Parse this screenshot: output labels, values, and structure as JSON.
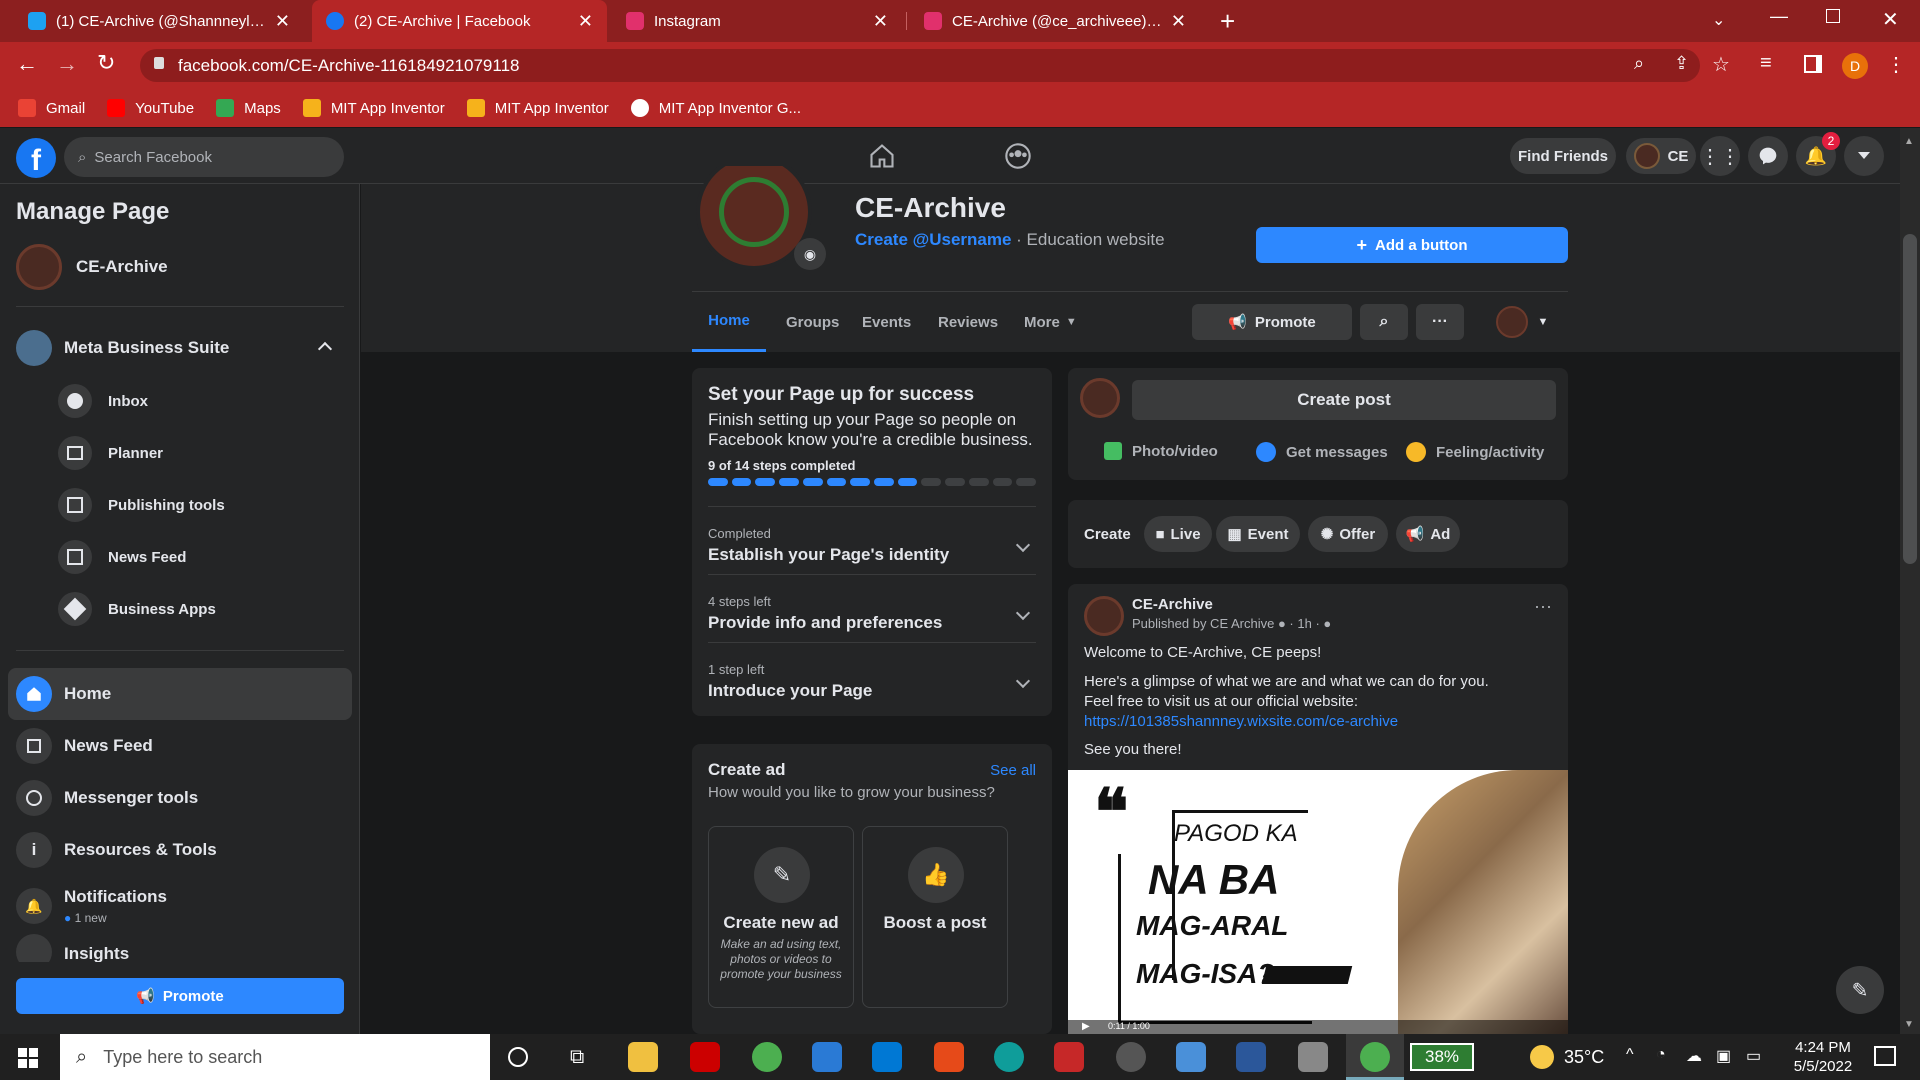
{
  "browser": {
    "tabs": [
      {
        "title": "(1) CE-Archive (@Shannneyl) / Tw",
        "icon_color": "#1da1f2",
        "active": false
      },
      {
        "title": "(2) CE-Archive | Facebook",
        "icon_color": "#1877f2",
        "active": true
      },
      {
        "title": "Instagram",
        "icon_color": "#e1306c",
        "active": false
      },
      {
        "title": "CE-Archive (@ce_archiveee) • Insta",
        "icon_color": "#e1306c",
        "active": false
      }
    ],
    "url": "facebook.com/CE-Archive-116184921079118",
    "profile_initial": "D",
    "bookmarks": [
      {
        "label": "Gmail",
        "color": "#ea4335"
      },
      {
        "label": "YouTube",
        "color": "#ff0000"
      },
      {
        "label": "Maps",
        "color": "#34a853"
      },
      {
        "label": "MIT App Inventor",
        "color": "#f6b21b"
      },
      {
        "label": "MIT App Inventor",
        "color": "#f6b21b"
      },
      {
        "label": "MIT App Inventor G...",
        "color": "#ffffff"
      }
    ]
  },
  "fb_header": {
    "search_placeholder": "Search Facebook",
    "find_friends": "Find Friends",
    "profile_short": "CE",
    "notification_count": "2"
  },
  "sidebar": {
    "title": "Manage Page",
    "page_name": "CE-Archive",
    "suite_label": "Meta Business Suite",
    "sub_items": [
      "Inbox",
      "Planner",
      "Publishing tools",
      "News Feed",
      "Business Apps"
    ],
    "nav_items": [
      "Home",
      "News Feed",
      "Messenger tools",
      "Resources & Tools",
      "Notifications",
      "Insights"
    ],
    "notifications_sub": "1 new",
    "promote_label": "Promote"
  },
  "page_header": {
    "name": "CE-Archive",
    "username_link": "Create @Username",
    "category": "· Education website",
    "add_button": "Add a button",
    "tabs": [
      "Home",
      "Groups",
      "Events",
      "Reviews",
      "More"
    ],
    "promote": "Promote"
  },
  "setup_card": {
    "title": "Set your Page up for success",
    "desc": "Finish setting up your Page so people on Facebook know you're a credible business.",
    "progress_text": "9 of 14 steps completed",
    "steps_done": 9,
    "steps_total": 14,
    "steps": [
      {
        "status": "Completed",
        "label": "Establish your Page's identity"
      },
      {
        "status": "4 steps left",
        "label": "Provide info and preferences"
      },
      {
        "status": "1 step left",
        "label": "Introduce your Page"
      }
    ]
  },
  "create_ad": {
    "title": "Create ad",
    "see_all": "See all",
    "subtitle": "How would you like to grow your business?",
    "option1_title": "Create new ad",
    "option1_desc": "Make an ad using text, photos or videos to promote your business",
    "option2_title": "Boost a post"
  },
  "composer": {
    "create_post": "Create post",
    "photo": "Photo/video",
    "messages": "Get messages",
    "feeling": "Feeling/activity"
  },
  "create_bar": {
    "label": "Create",
    "items": [
      "Live",
      "Event",
      "Offer",
      "Ad"
    ]
  },
  "post": {
    "author": "CE-Archive",
    "meta": "Published by CE Archive ● · 1h · ●",
    "line1": "Welcome to CE-Archive, CE peeps!",
    "line2": "Here's a glimpse of what we are and what we can do for you.",
    "line3": "Feel free to visit us at our official website:",
    "link": "https://101385shannney.wixsite.com/ce-archive",
    "line4": "See you there!",
    "image_text": [
      "PAGOD KA",
      "NA BA",
      "MAG-ARAL",
      "MAG-ISA?"
    ],
    "video_time": "0:11 / 1:00"
  },
  "taskbar": {
    "search_placeholder": "Type here to search",
    "battery": "38%",
    "temperature": "35°C",
    "time": "4:24 PM",
    "date": "5/5/2022"
  }
}
